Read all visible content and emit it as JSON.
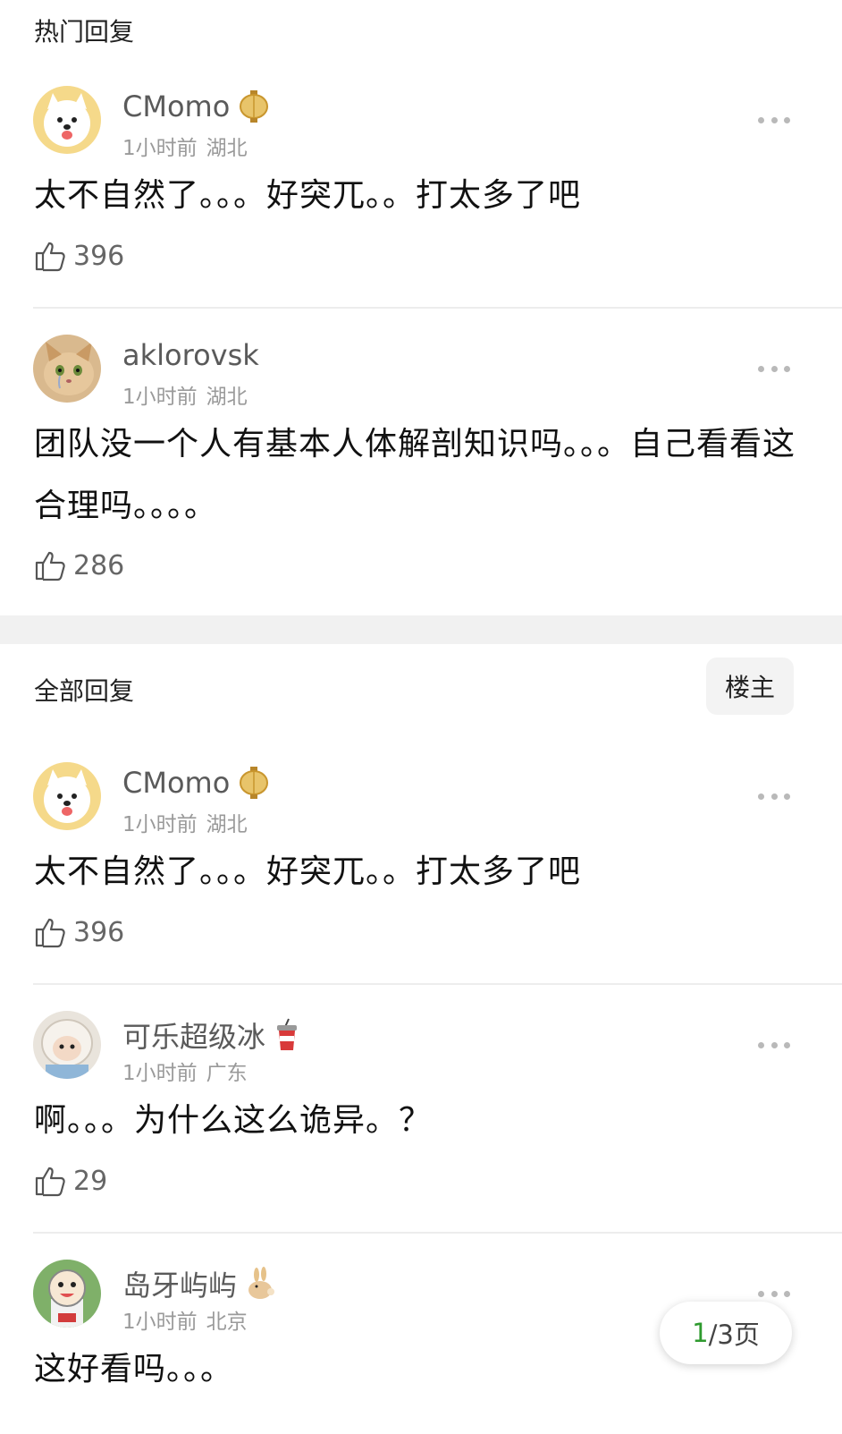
{
  "hot_section": {
    "title": "热门回复"
  },
  "all_section": {
    "title": "全部回复",
    "op_button": "楼主"
  },
  "hot_comments": [
    {
      "user": "CMomo",
      "badge": "lantern-icon",
      "time": "1小时前",
      "location": "湖北",
      "text": "太不自然了。。。好突兀。。打太多了吧",
      "likes": "396"
    },
    {
      "user": "aklorovsk",
      "badge": "",
      "time": "1小时前",
      "location": "湖北",
      "text": "团队没一个人有基本人体解剖知识吗。。。自己看看这合理吗。。。。",
      "likes": "286"
    }
  ],
  "all_comments": [
    {
      "user": "CMomo",
      "badge": "lantern-icon",
      "time": "1小时前",
      "location": "湖北",
      "text": "太不自然了。。。好突兀。。打太多了吧",
      "likes": "396"
    },
    {
      "user": "可乐超级冰",
      "badge": "cola-icon",
      "time": "1小时前",
      "location": "广东",
      "text": "啊。。。为什么这么诡异。？",
      "likes": "29"
    },
    {
      "user": "岛牙屿屿",
      "badge": "rabbit-icon",
      "time": "1小时前",
      "location": "北京",
      "text": "这好看吗。。。",
      "likes": ""
    }
  ],
  "pager": {
    "current": "1",
    "rest": "/3页"
  },
  "colors": {
    "accent": "#2e9a2e",
    "meta": "#9a9a9a"
  }
}
